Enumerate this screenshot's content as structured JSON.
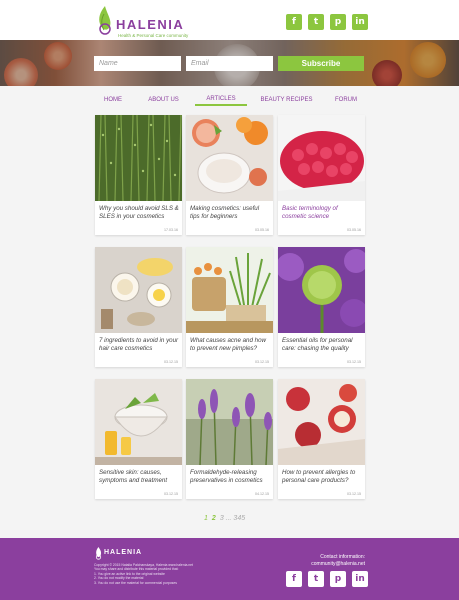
{
  "header": {
    "brand": "HALENIA",
    "tagline": "Health & Personal Care community",
    "social": [
      {
        "icon": "facebook-icon",
        "glyph": "f"
      },
      {
        "icon": "twitter-icon",
        "glyph": "t"
      },
      {
        "icon": "pinterest-icon",
        "glyph": "p"
      },
      {
        "icon": "linkedin-icon",
        "glyph": "in"
      }
    ]
  },
  "signup": {
    "name_placeholder": "Name",
    "email_placeholder": "Email",
    "subscribe_label": "Subscribe"
  },
  "nav": {
    "items": [
      "HOME",
      "ABOUT US",
      "ARTICLES",
      "BEAUTY RECIPES",
      "FORUM"
    ],
    "active": "ARTICLES"
  },
  "articles": [
    {
      "title": "Why you should avoid SLS & SLES in your cosmetics",
      "date": "17.03.16"
    },
    {
      "title": "Making cosmetics: useful tips for beginners",
      "date": "03.05.16"
    },
    {
      "title": "Basic terminology of cosmetic science",
      "date": "03.05.16"
    },
    {
      "title": "7 ingredients to avoid in your hair care cosmetics",
      "date": "03.12.15"
    },
    {
      "title": "What causes acne and how to prevent new pimples?",
      "date": "03.12.15"
    },
    {
      "title": "Essential oils for personal care: chasing the quality",
      "date": "03.12.15"
    },
    {
      "title": "Sensitive skin: causes, symptoms and treatment",
      "date": "03.12.15"
    },
    {
      "title": "Formaldehyde-releasing preservatives in cosmetics",
      "date": "04.12.15"
    },
    {
      "title": "How to prevent allergies to personal care products?",
      "date": "03.12.15"
    }
  ],
  "pagination": {
    "prev": "1",
    "current": "2",
    "rest": "3 ... 345"
  },
  "footer": {
    "brand": "HALENIA",
    "copyright": "Copyright © 2015 Natalia Palchanskaya, Halenia www.halenia.net",
    "notes": [
      "You may share and distribute this material provided that:",
      "1. You give an active link to the original website",
      "2. You do not modify the material",
      "3. You do not use the material for commercial purposes"
    ],
    "contact_label": "Contact information:",
    "contact_email": "community@halenia.net"
  },
  "colors": {
    "brand_purple": "#8b3f9e",
    "accent_green": "#8cc63f"
  }
}
